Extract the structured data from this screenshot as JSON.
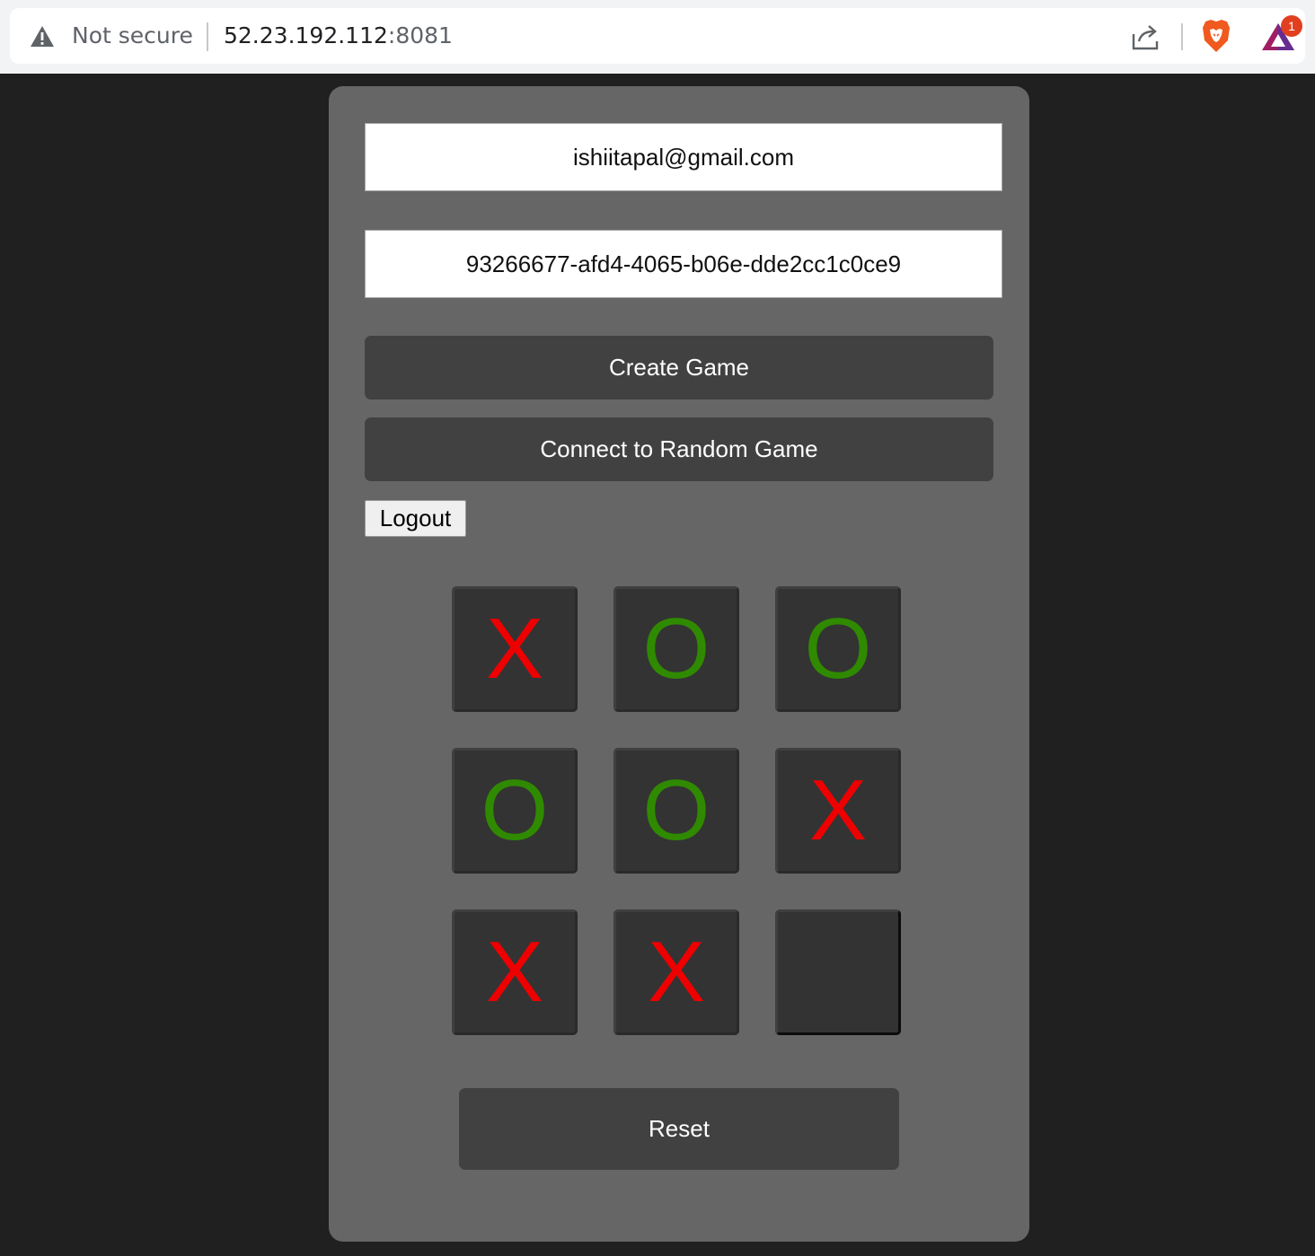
{
  "browser": {
    "security_label": "Not secure",
    "url_host": "52.23.192.112",
    "url_port": ":8081",
    "notification_count": "1"
  },
  "form": {
    "email_value": "ishiitapal@gmail.com",
    "game_id_value": "93266677-afd4-4065-b06e-dde2cc1c0ce9",
    "create_game_label": "Create Game",
    "connect_random_label": "Connect to Random Game",
    "logout_label": "Logout"
  },
  "board": {
    "cells": [
      "X",
      "O",
      "O",
      "O",
      "O",
      "X",
      "X",
      "X",
      ""
    ],
    "colors": {
      "X": "#ee0000",
      "O": "#2f8a00"
    }
  },
  "reset_label": "Reset"
}
